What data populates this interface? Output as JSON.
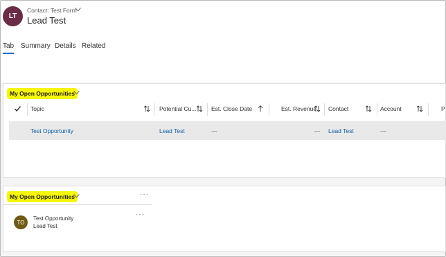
{
  "header": {
    "avatar_initials": "LT",
    "form_selector_label": "Contact: Test Form",
    "record_name": "Lead Test"
  },
  "tabs": [
    {
      "label": "Tab",
      "active": true
    },
    {
      "label": "Summary",
      "active": false
    },
    {
      "label": "Details",
      "active": false
    },
    {
      "label": "Related",
      "active": false
    }
  ],
  "grid_section": {
    "title": "My Open Opportunities",
    "columns": [
      {
        "label": "Topic",
        "sort": "sortable"
      },
      {
        "label": "Potential Cu...",
        "sort": "sortable"
      },
      {
        "label": "Est. Close Date",
        "sort": "ascending"
      },
      {
        "label": "Est. Revenue",
        "sort": "sortable"
      },
      {
        "label": "Contact",
        "sort": "sortable"
      },
      {
        "label": "Account",
        "sort": "sortable"
      },
      {
        "label": "P",
        "sort": "none"
      }
    ],
    "rows": [
      {
        "topic": "Test Opportunity",
        "potential_customer": "Lead Test",
        "est_close_date": "---",
        "est_revenue": "---",
        "contact": "Lead Test",
        "account": "---"
      }
    ]
  },
  "list_section": {
    "title": "My Open Opportunities",
    "more_label": "···",
    "items": [
      {
        "avatar_initials": "TO",
        "title": "Test Opportunity",
        "subtitle": "Lead Test",
        "more_label": "···"
      }
    ]
  },
  "colors": {
    "accent": "#0f6cbd",
    "link": "#115ea3",
    "highlight": "#f6f60a",
    "avatar_lead": "#6b2c47",
    "avatar_opportunity": "#6e5a12",
    "selected_row": "#e9e9e9"
  }
}
